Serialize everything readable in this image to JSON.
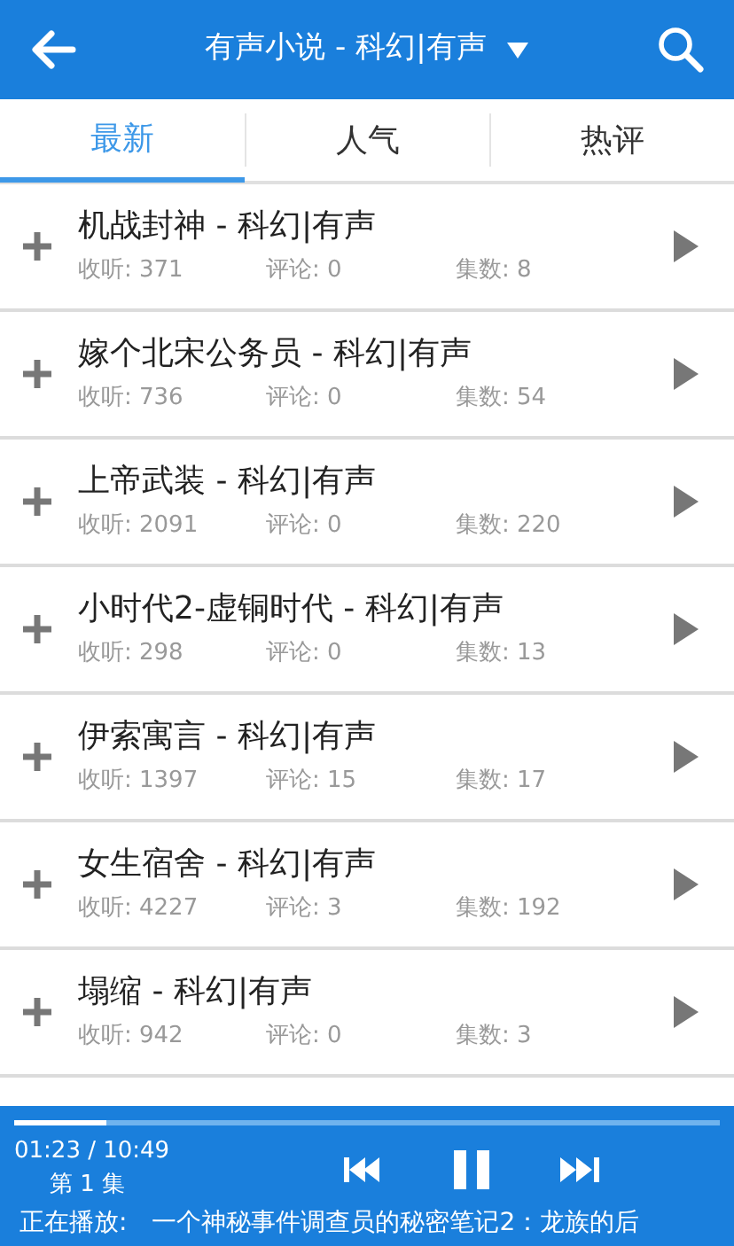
{
  "header": {
    "title": "有声小说 - 科幻|有声"
  },
  "tabs": [
    {
      "label": "最新",
      "selected": true
    },
    {
      "label": "人气",
      "selected": false
    },
    {
      "label": "热评",
      "selected": false
    }
  ],
  "items": [
    {
      "title": "机战封神 - 科幻|有声",
      "listens": "收听: 371",
      "comments": "评论: 0",
      "episodes": "集数: 8"
    },
    {
      "title": "嫁个北宋公务员 - 科幻|有声",
      "listens": "收听: 736",
      "comments": "评论: 0",
      "episodes": "集数: 54"
    },
    {
      "title": "上帝武装 - 科幻|有声",
      "listens": "收听: 2091",
      "comments": "评论: 0",
      "episodes": "集数: 220"
    },
    {
      "title": "小时代2-虚铜时代 - 科幻|有声",
      "listens": "收听: 298",
      "comments": "评论: 0",
      "episodes": "集数: 13"
    },
    {
      "title": "伊索寓言 - 科幻|有声",
      "listens": "收听: 1397",
      "comments": "评论: 15",
      "episodes": "集数: 17"
    },
    {
      "title": "女生宿舍 - 科幻|有声",
      "listens": "收听: 4227",
      "comments": "评论: 3",
      "episodes": "集数: 192"
    },
    {
      "title": "塌缩 - 科幻|有声",
      "listens": "收听: 942",
      "comments": "评论: 0",
      "episodes": "集数: 3"
    }
  ],
  "player": {
    "level": 0.13,
    "time": "01:23 / 10:49",
    "episode": "第 1 集",
    "playing": true,
    "now_playing_label": "正在播放:",
    "now_playing_title": "一个神秘事件调查员的秘密笔记2：龙族的后"
  }
}
